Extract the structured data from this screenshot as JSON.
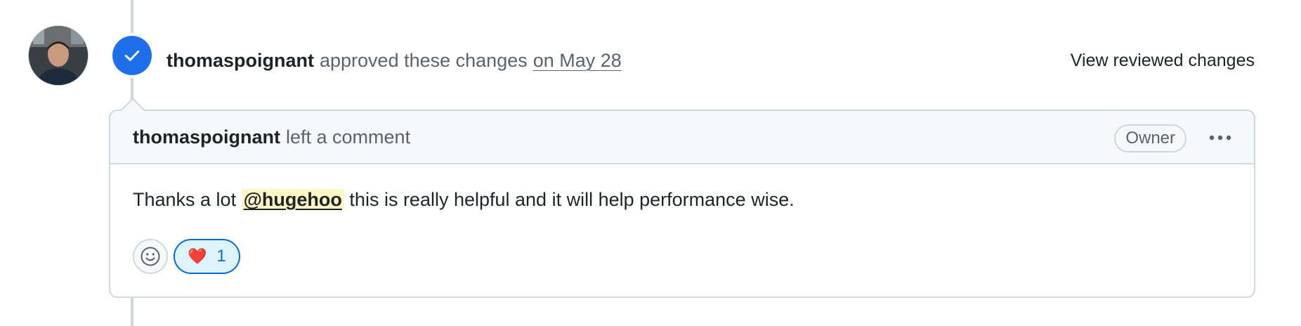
{
  "review_event": {
    "author": "thomaspoignant",
    "action": "approved these changes",
    "date": "on May 28",
    "view_reviewed_label": "View reviewed changes"
  },
  "comment": {
    "author": "thomaspoignant",
    "action": "left a comment",
    "role_badge": "Owner",
    "body_prefix": "Thanks a lot",
    "mention": "@hugehoo",
    "body_suffix": "this is really helpful and it will help performance wise.",
    "reactions": [
      {
        "emoji": "❤️",
        "count": "1"
      }
    ]
  },
  "icons": {
    "approve": "check-icon",
    "more": "kebab-horizontal-icon",
    "add_reaction": "smiley-icon"
  },
  "colors": {
    "approve_badge": "#1f6feb",
    "reaction_border": "#0969da",
    "reaction_bg": "#ddf4ff",
    "mention_bg": "#fff8c5"
  }
}
